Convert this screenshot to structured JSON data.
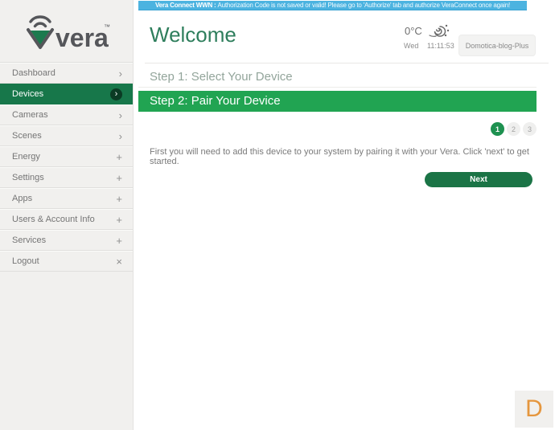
{
  "banner": {
    "label": "Vera Connect WWN :",
    "message": "Authorization Code is not saved or valid! Please go to 'Authorize' tab and authorize VeraConnect once again!"
  },
  "sidebar": {
    "logo_text": "vera",
    "logo_tm": "™",
    "items": [
      {
        "label": "Dashboard",
        "icon": "›"
      },
      {
        "label": "Devices",
        "icon": "›"
      },
      {
        "label": "Cameras",
        "icon": "›"
      },
      {
        "label": "Scenes",
        "icon": "›"
      },
      {
        "label": "Energy",
        "icon": "+"
      },
      {
        "label": "Settings",
        "icon": "+"
      },
      {
        "label": "Apps",
        "icon": "+"
      },
      {
        "label": "Users & Account Info",
        "icon": "+"
      },
      {
        "label": "Services",
        "icon": "+"
      },
      {
        "label": "Logout",
        "icon": "×"
      }
    ]
  },
  "header": {
    "title": "Welcome",
    "weather": {
      "temperature": "0°C",
      "day": "Wed",
      "time": "11:11:53"
    },
    "controller_name": "Domotica-blog-Plus"
  },
  "wizard": {
    "step1_title": "Step 1: Select Your Device",
    "step2_title": "Step 2: Pair Your Device",
    "steps": [
      "1",
      "2",
      "3"
    ],
    "active_step": "1",
    "description": "First you will need to add this device to your system by pairing it with your Vera. Click 'next' to get started.",
    "next_label": "Next"
  },
  "watermark": {
    "letter": "D"
  },
  "colors": {
    "sidebar_active_green": "#17774a",
    "step_bar_green": "#21a452",
    "next_button_green": "#1b7446",
    "banner_blue": "#4cb3e0",
    "heading_green": "#2e7e5c",
    "watermark_orange": "#e5963e"
  }
}
